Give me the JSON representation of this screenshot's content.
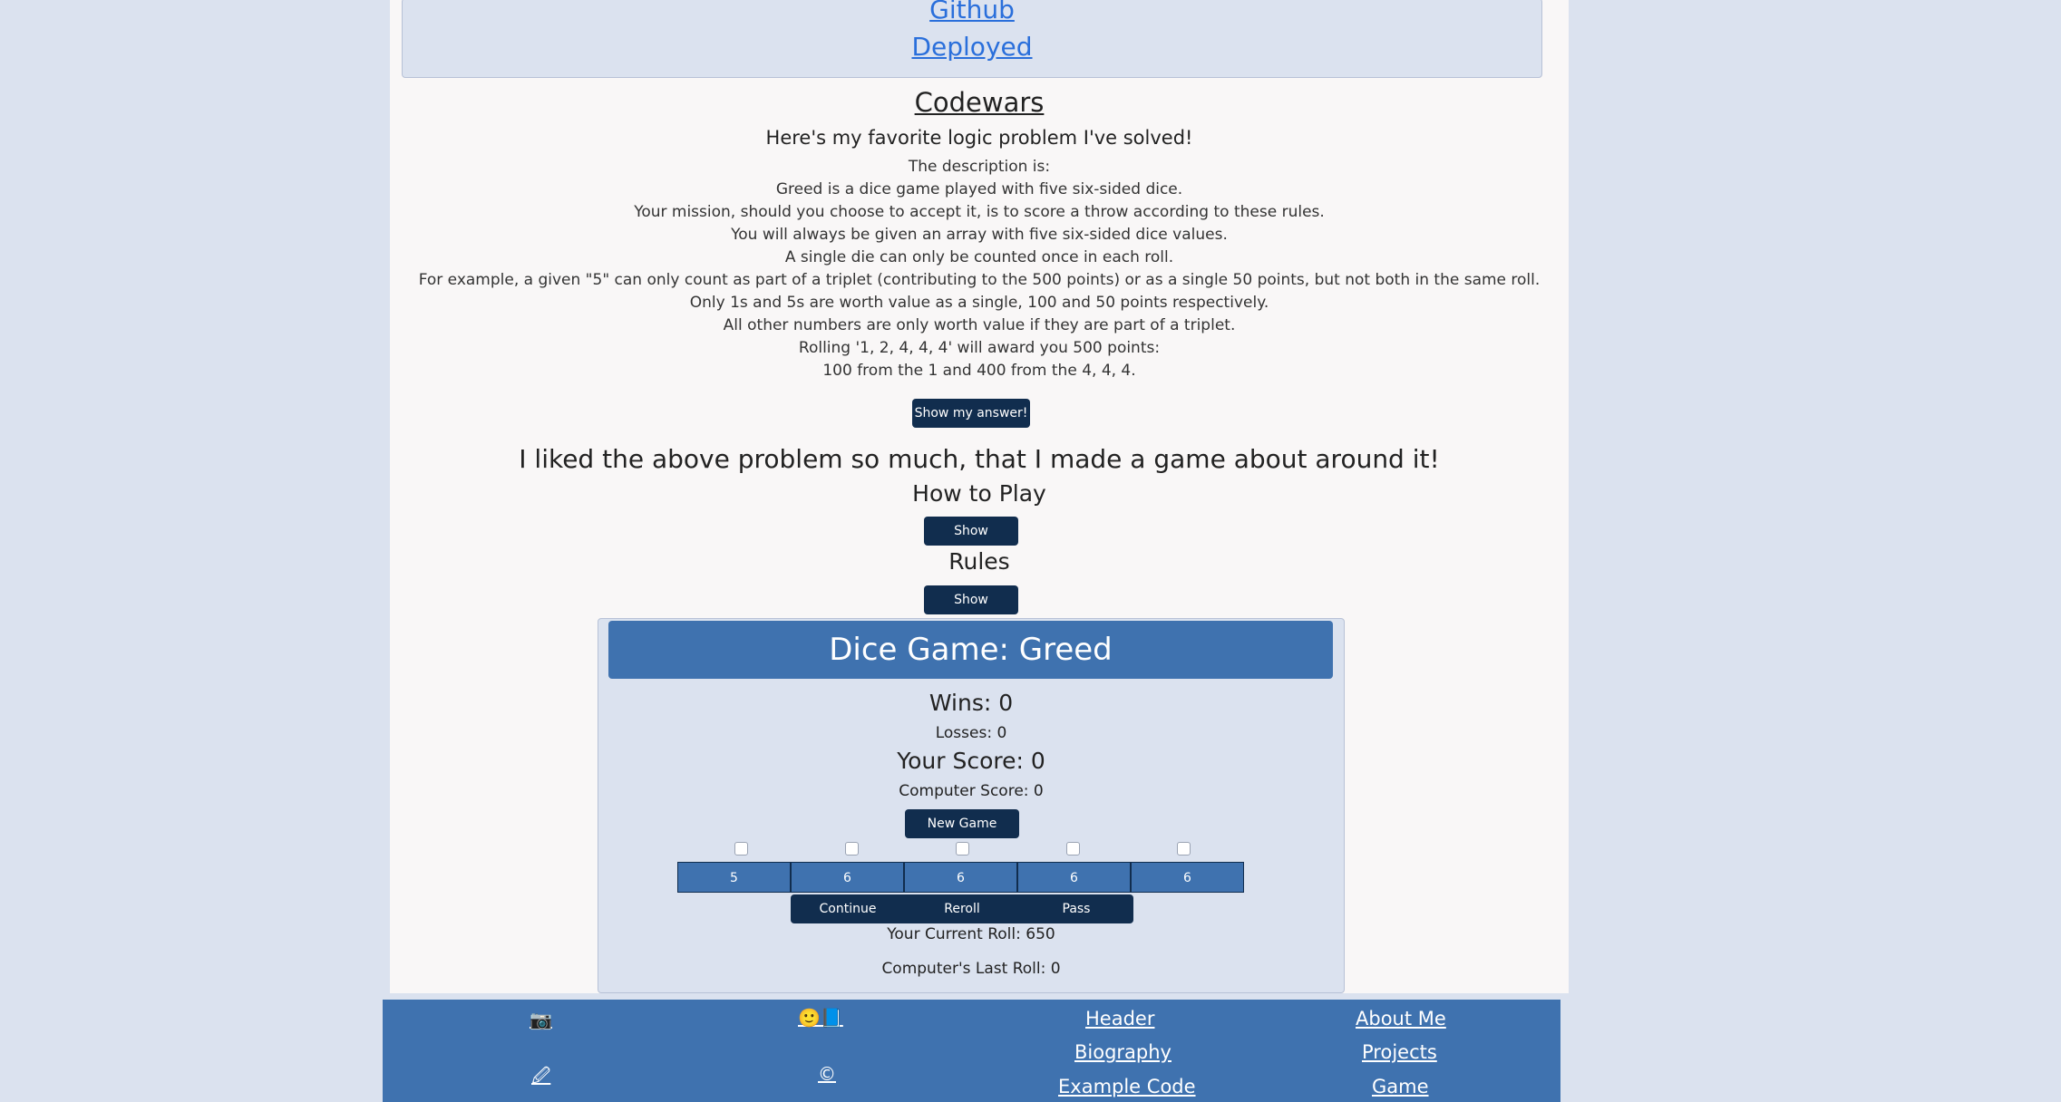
{
  "links": {
    "github": "Github",
    "deployed": "Deployed"
  },
  "codewars": {
    "title": "Codewars",
    "subtitle": "Here's my favorite logic problem I've solved!",
    "description": [
      "The description is:",
      "Greed is a dice game played with five six-sided dice.",
      "Your mission, should you choose to accept it, is to score a throw according to these rules.",
      "You will always be given an array with five six-sided dice values.",
      "A single die can only be counted once in each roll.",
      "For example, a given \"5\" can only count as part of a triplet (contributing to the 500 points) or as a single 50 points, but not both in the same roll.",
      "Only 1s and 5s are worth value as a single, 100 and 50 points respectively.",
      "All other numbers are only worth value if they are part of a triplet.",
      "Rolling '1, 2, 4, 4, 4' will award you 500 points:",
      "100 from the 1 and 400 from the 4, 4, 4."
    ],
    "show_answer_label": "Show my answer!"
  },
  "game_intro": {
    "liked": "I liked the above problem so much, that I made a game about around it!",
    "how_to_play": "How to Play",
    "show_label": "Show",
    "rules": "Rules"
  },
  "game": {
    "title": "Dice Game: Greed",
    "wins": "Wins: 0",
    "losses": "Losses: 0",
    "your_score": "Your Score: 0",
    "computer_score": "Computer Score: 0",
    "new_game_label": "New Game",
    "dice": [
      "5",
      "6",
      "6",
      "6",
      "6"
    ],
    "actions": {
      "continue": "Continue",
      "reroll": "Reroll",
      "pass": "Pass"
    },
    "current_roll": "Your Current Roll: 650",
    "last_roll": "Computer's Last Roll: 0"
  },
  "footer": {
    "icons": {
      "photo": "📷",
      "face_book": "🙂📘",
      "pencil": "🖉",
      "copyright": "©"
    },
    "links": {
      "header": "Header",
      "biography": "Biography",
      "example_code": "Example Code",
      "about_me": "About Me",
      "projects": "Projects",
      "game": "Game"
    }
  }
}
